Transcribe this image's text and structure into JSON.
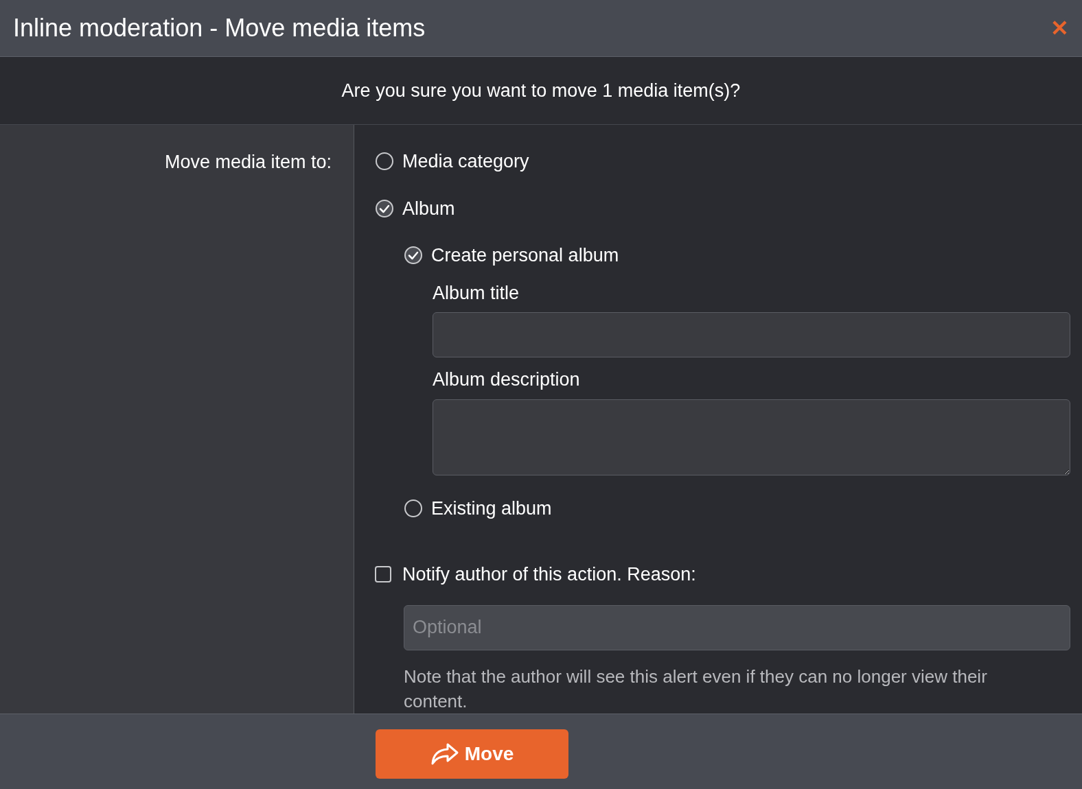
{
  "dialog": {
    "title": "Inline moderation - Move media items",
    "close": "✕"
  },
  "question": "Are you sure you want to move 1 media item(s)?",
  "form": {
    "label": "Move media item to:",
    "options": [
      {
        "label": "Media category",
        "selected": false
      },
      {
        "label": "Album",
        "selected": true,
        "children": [
          {
            "label": "Create personal album",
            "selected": true,
            "fields": [
              {
                "label": "Album title",
                "kind": "input"
              },
              {
                "label": "Album description",
                "kind": "textarea"
              }
            ]
          },
          {
            "label": "Existing album",
            "selected": false
          }
        ]
      }
    ],
    "notify": {
      "label": "Notify author of this action. Reason:",
      "checked": false,
      "placeholder": "Optional",
      "note": "Note that the author will see this alert even if they can no longer view their content."
    }
  },
  "footer": {
    "button": "Move"
  }
}
